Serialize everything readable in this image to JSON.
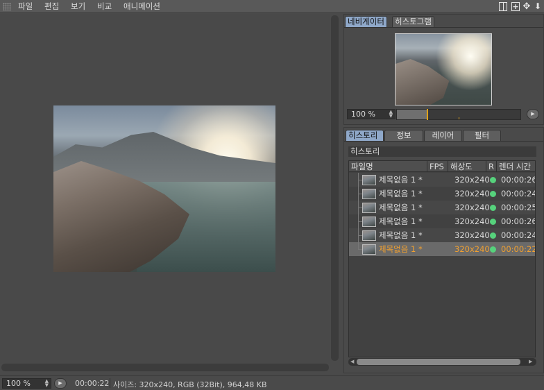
{
  "menu": {
    "items": [
      "파일",
      "편집",
      "보기",
      "비교",
      "애니메이션"
    ]
  },
  "navigator": {
    "tabs": [
      "네비게이터",
      "히스토그램"
    ],
    "zoom": "100 %",
    "progress": 0.25
  },
  "history": {
    "tabs": [
      "히스토리",
      "정보",
      "레이어",
      "필터"
    ],
    "section_title": "히스토리",
    "columns": [
      "파일명",
      "FPS",
      "해상도",
      "R",
      "렌더 시간"
    ],
    "rows": [
      {
        "name": "제목없음 1 *",
        "resolution": "320x240",
        "time": "00:00:26"
      },
      {
        "name": "제목없음 1 *",
        "resolution": "320x240",
        "time": "00:00:24"
      },
      {
        "name": "제목없음 1 *",
        "resolution": "320x240",
        "time": "00:00:25"
      },
      {
        "name": "제목없음 1 *",
        "resolution": "320x240",
        "time": "00:00:26"
      },
      {
        "name": "제목없음 1 *",
        "resolution": "320x240",
        "time": "00:00:24"
      },
      {
        "name": "제목없음 1 *",
        "resolution": "320x240",
        "time": "00:00:22"
      }
    ],
    "selected_index": 5,
    "status_color": "#56d27c",
    "highlight_color": "#f0a030"
  },
  "status": {
    "zoom": "100 %",
    "time": "00:00:22",
    "info": "사이즈: 320x240, RGB (32Bit), 964,48 KB"
  },
  "icons": {
    "panel": "panel-layout-icon",
    "add": "add-panel-icon",
    "move": "move-icon",
    "down": "arrow-down-icon"
  }
}
